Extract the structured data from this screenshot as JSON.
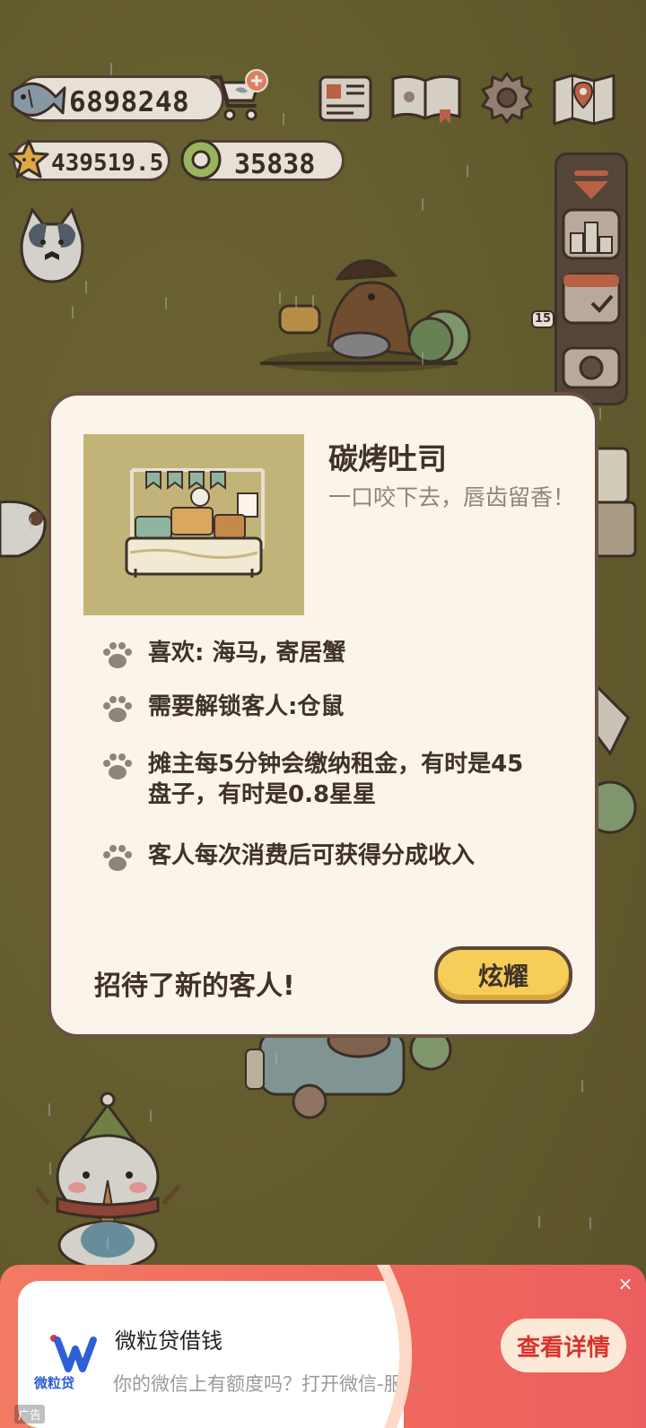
{
  "hud": {
    "fish_count": "6898248",
    "star_count": "439519.5",
    "ring_count": "35838",
    "side_badge": "15"
  },
  "icons": {
    "fish": "fish-icon",
    "cart": "shop-cart-plus-icon",
    "star": "star-icon",
    "ring": "ring-currency-icon",
    "newspaper": "newspaper-icon",
    "book": "catalog-book-icon",
    "settings": "gear-icon",
    "map": "map-icon",
    "collapse": "collapse-arrow-icon",
    "ranking": "ranking-podium-icon",
    "calendar": "calendar-check-icon",
    "camera": "camera-icon",
    "paw": "paw-icon"
  },
  "modal": {
    "title": "碳烤吐司",
    "description": "一口咬下去，唇齿留香！",
    "items": [
      "喜欢: 海马, 寄居蟹",
      "需要解锁客人:仓鼠",
      "摊主每5分钟会缴纳租金，有时是45盘子，有时是0.8星星",
      "客人每次消费后可获得分成收入"
    ],
    "footer_text": "招待了新的客人!",
    "show_button": "炫耀"
  },
  "ad": {
    "brand_label": "微粒贷",
    "title": "微粒贷借钱",
    "subtitle": "你的微信上有额度吗？打开微信-服…",
    "cta": "查看详情",
    "close": "×",
    "tag": "广告"
  },
  "colors": {
    "background": "#6d6533",
    "modal_bg": "#fbf4ea",
    "modal_border": "#6a5242",
    "button_yellow": "#f6cd57",
    "ad_gradient": "#f06a5c",
    "ad_cta_text": "#d8332b"
  }
}
